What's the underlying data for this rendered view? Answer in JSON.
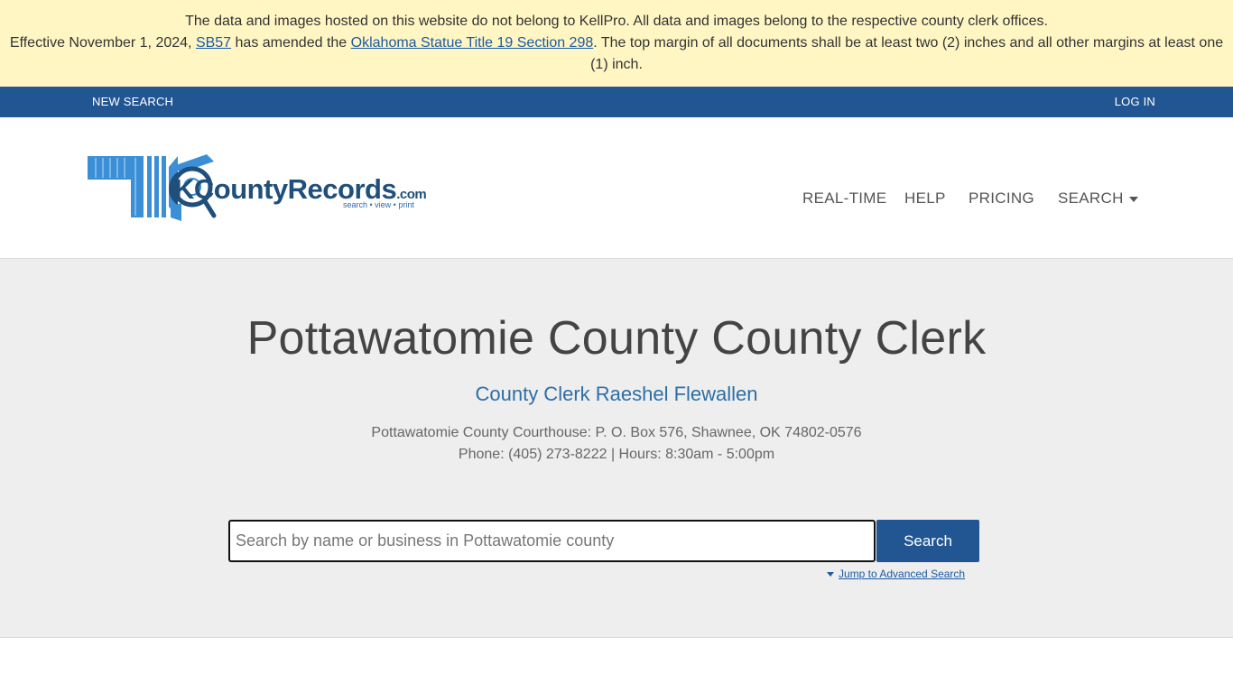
{
  "notice": {
    "line1": "The data and images hosted on this website do not belong to KellPro. All data and images belong to the respective county clerk offices.",
    "line2_prefix": "Effective November 1, 2024,",
    "sb57_link": "SB57",
    "line2_mid": "has amended the",
    "statute_link": "Oklahoma Statue Title 19 Section 298",
    "line2_suffix": ". The top margin of all documents shall be at least two (2) inches and all other margins at least one (1) inch."
  },
  "topbar": {
    "new_search": "NEW SEARCH",
    "login": "LOG IN"
  },
  "logo": {
    "text": "KCountyRecords",
    "dotcom": ".com",
    "tagline": "search • view • print"
  },
  "nav": {
    "realtime": "REAL-TIME",
    "help": "HELP",
    "pricing": "PRICING",
    "search": "SEARCH"
  },
  "hero": {
    "title": "Pottawatomie County County Clerk",
    "subtitle": "County Clerk Raeshel Flewallen",
    "address": "Pottawatomie County Courthouse: P. O. Box 576, Shawnee, OK 74802-0576",
    "contact": "Phone: (405) 273-8222 | Hours: 8:30am - 5:00pm"
  },
  "search": {
    "placeholder": "Search by name or business in Pottawatomie county",
    "value": "",
    "button": "Search",
    "advanced_link": "Jump to Advanced Search"
  },
  "colors": {
    "notice_bg": "#fff6c4",
    "topbar_bg": "#225692",
    "hero_bg": "#eeeeee",
    "accent": "#2d6ea6",
    "link": "#1a5aa5"
  },
  "icons": {
    "logo": "okcountyrecords-logo",
    "nav_caret": "caret-down-icon",
    "advanced_caret": "caret-down-icon"
  }
}
